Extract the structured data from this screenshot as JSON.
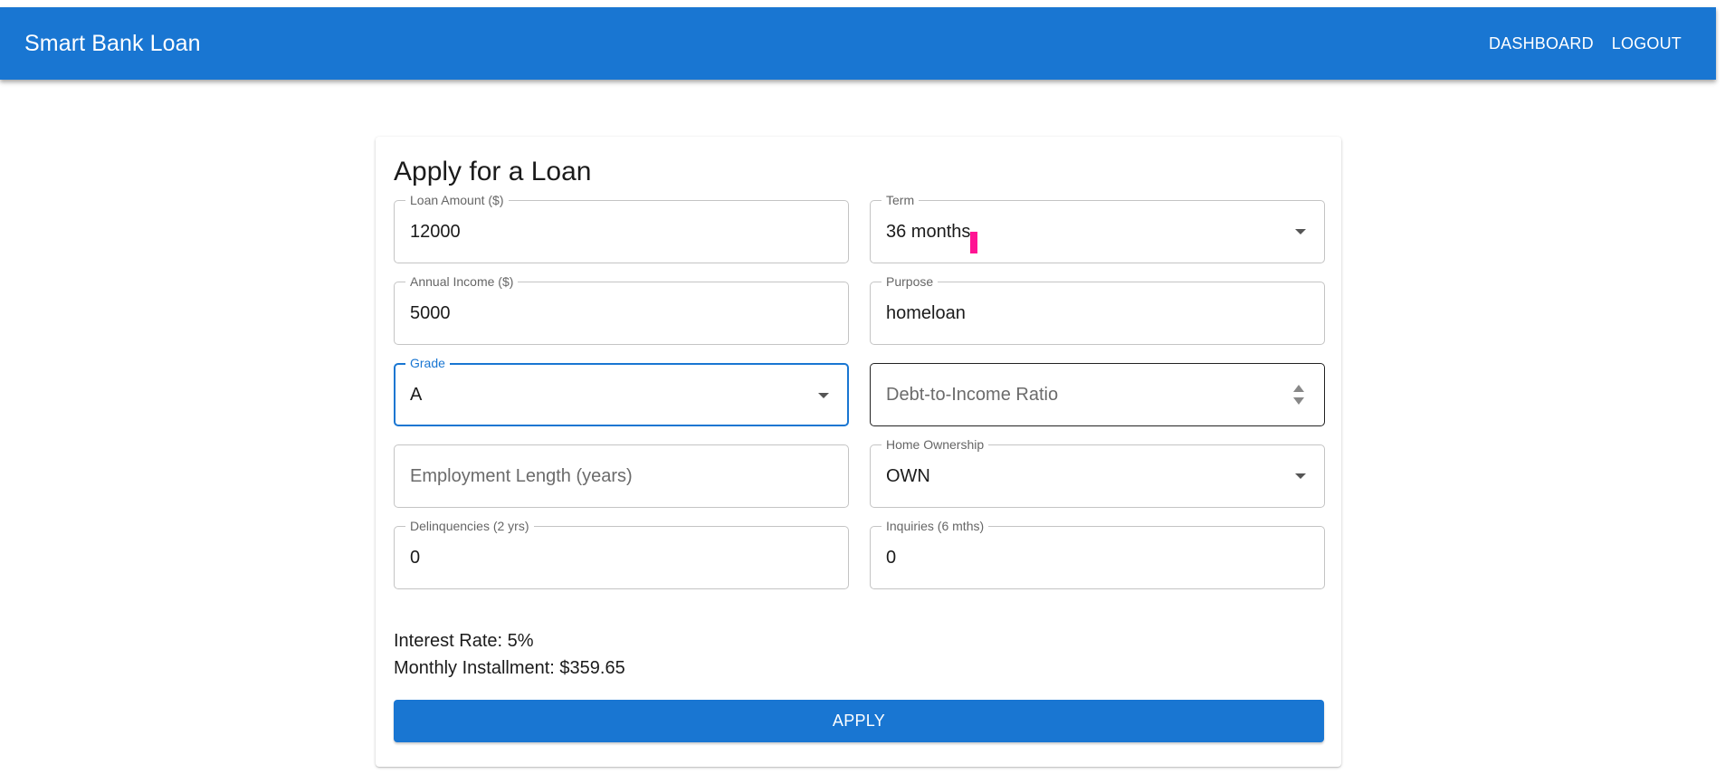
{
  "appbar": {
    "title": "Smart Bank Loan",
    "nav": [
      "DASHBOARD",
      "LOGOUT"
    ]
  },
  "form": {
    "title": "Apply for a Loan",
    "fields": {
      "loan_amount": {
        "label": "Loan Amount ($)",
        "value": "12000"
      },
      "term": {
        "label": "Term",
        "value": "36 months"
      },
      "annual_income": {
        "label": "Annual Income ($)",
        "value": "5000"
      },
      "purpose": {
        "label": "Purpose",
        "value": "homeloan"
      },
      "grade": {
        "label": "Grade",
        "value": "A"
      },
      "dti": {
        "placeholder": "Debt-to-Income Ratio"
      },
      "employment_length": {
        "placeholder": "Employment Length (years)"
      },
      "home_ownership": {
        "label": "Home Ownership",
        "value": "OWN"
      },
      "delinquencies": {
        "label": "Delinquencies (2 yrs)",
        "value": "0"
      },
      "inquiries": {
        "label": "Inquiries (6 mths)",
        "value": "0"
      }
    },
    "summary": {
      "interest_rate": "Interest Rate: 5%",
      "monthly_installment": "Monthly Installment: $359.65"
    },
    "apply_label": "APPLY"
  },
  "colors": {
    "primary": "#1976d2",
    "cursor_marker": "#ff1493"
  }
}
